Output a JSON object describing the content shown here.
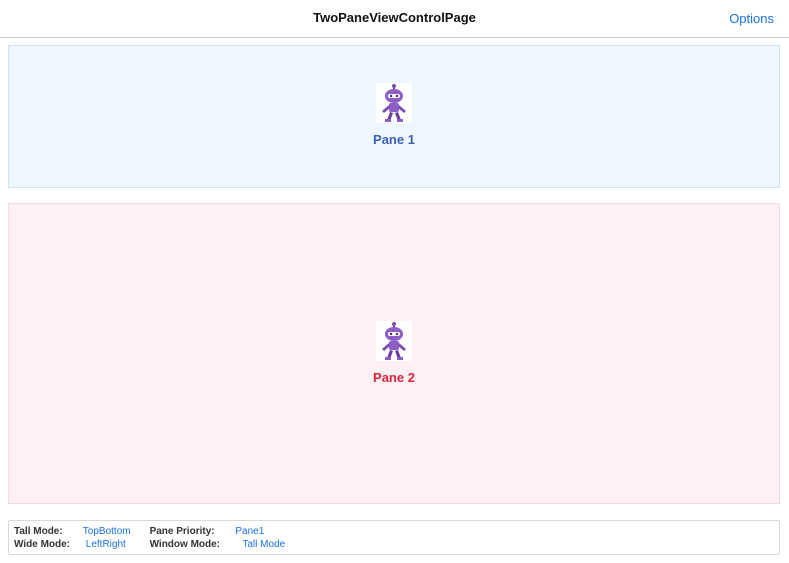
{
  "navbar": {
    "title": "TwoPaneViewControlPage",
    "options_label": "Options"
  },
  "panes": {
    "pane1": {
      "label": "Pane 1",
      "icon": "robot-mascot-icon"
    },
    "pane2": {
      "label": "Pane 2",
      "icon": "robot-mascot-icon"
    }
  },
  "status": {
    "tall_mode_label": "Tall Mode:",
    "tall_mode_value": "TopBottom",
    "pane_priority_label": "Pane Priority:",
    "pane_priority_value": "Pane1",
    "wide_mode_label": "Wide Mode:",
    "wide_mode_value": "LeftRight",
    "window_mode_label": "Window Mode:",
    "window_mode_value": "Tall Mode"
  },
  "colors": {
    "accent": "#1a73e8",
    "pane1_bg": "#eef6ff",
    "pane2_bg": "#fff0f4",
    "pane1_text": "#3b5fb6",
    "pane2_text": "#d7263d"
  }
}
